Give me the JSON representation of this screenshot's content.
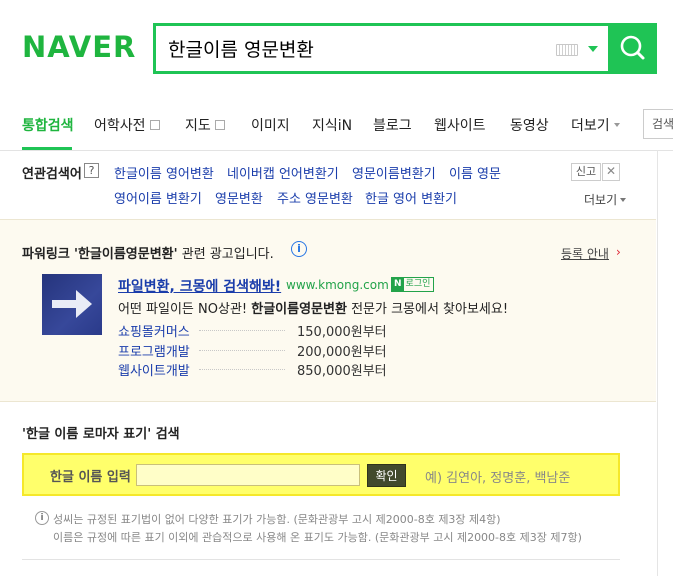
{
  "header": {
    "logo": "NAVER",
    "query": "한글이름 영문변환"
  },
  "tabs": [
    {
      "label": "통합검색"
    },
    {
      "label": "어학사전"
    },
    {
      "label": "지도"
    },
    {
      "label": "이미지"
    },
    {
      "label": "지식iN"
    },
    {
      "label": "블로그"
    },
    {
      "label": "웹사이트"
    },
    {
      "label": "동영상"
    },
    {
      "label": "더보기"
    }
  ],
  "tabs_extra": "검색",
  "related": {
    "title": "연관검색어",
    "help": "?",
    "items": [
      "한글이름 영어변환",
      "네이버캡 언어변환기",
      "영문이름변환기",
      "이름 영문",
      "영어이름 변환기",
      "영문변환",
      "주소 영문변환",
      "한글 영어 변환기"
    ],
    "report": "신고",
    "close": "✕",
    "more": "더보기"
  },
  "powerlink": {
    "label": "파워링크",
    "keyword": "'한글이름영문변환'",
    "suffix": "관련 광고입니다.",
    "info": "i",
    "register": "등록 안내",
    "register_arrow": "›",
    "ad": {
      "title": "파일변환, 크몽에 검색해봐!",
      "url": "www.kmong.com",
      "badge_n": "N",
      "badge_text": "로그인",
      "desc_pre": "어떤 파일이든 NO상관! ",
      "desc_bold": "한글이름영문변환",
      "desc_post": " 전문가 크몽에서 찾아보세요!",
      "sublinks": [
        {
          "name": "쇼핑몰커머스",
          "price": "150,000원부터"
        },
        {
          "name": "프로그램개발",
          "price": "200,000원부터"
        },
        {
          "name": "웹사이트개발",
          "price": "850,000원부터"
        }
      ]
    }
  },
  "roman": {
    "title": "'한글 이름 로마자 표기' 검색",
    "label": "한글 이름 입력",
    "input_value": "",
    "button": "확인",
    "example": "예) 김연아, 정명훈, 백남준",
    "note_icon": "i",
    "notes": [
      "성씨는 규정된 표기법이 없어 다양한 표기가 가능함. (문화관광부 고시 제2000-8호 제3장 제4항)",
      "이름은 규정에 따른 표기 이외에 관습적으로 사용해 온 표기도 가능함. (문화관광부 고시 제2000-8호 제3장 제7항)"
    ]
  }
}
